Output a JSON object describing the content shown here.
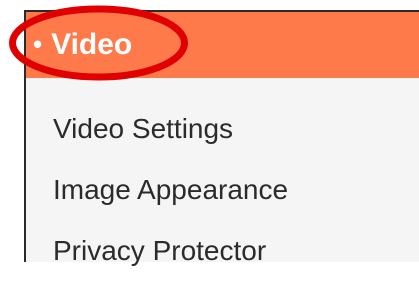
{
  "menu": {
    "header": {
      "bullet": "•",
      "label": "Video"
    },
    "items": [
      {
        "label": "Video Settings"
      },
      {
        "label": "Image Appearance"
      },
      {
        "label": "Privacy Protector"
      }
    ]
  },
  "colors": {
    "header_bg": "#ff7a4b",
    "header_text": "#ffffff",
    "item_text": "#2b2b2b",
    "menu_bg": "#f5f5f5",
    "highlight": "#e00000"
  }
}
